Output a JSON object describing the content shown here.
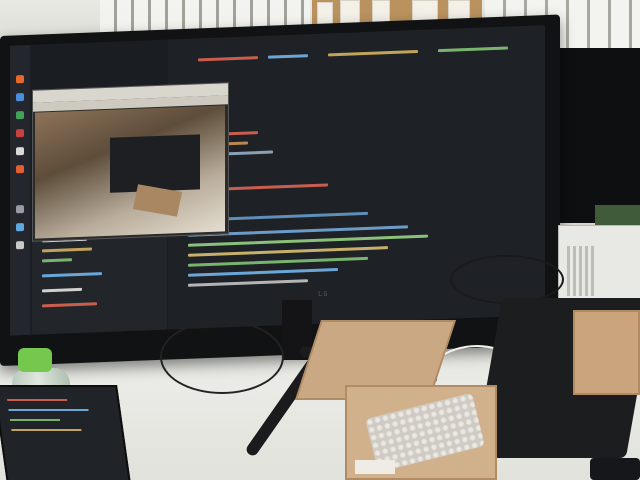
{
  "scene": {
    "description_visible_text": {
      "camera_window_title": "",
      "monitor_logo": "LG"
    }
  },
  "colors": {
    "screen_background": "#1a1d22",
    "cardboard": "#d1b08c",
    "bottle_cap": "#74c84d",
    "desk": "#e2e2dc"
  },
  "icons": [
    "dock-icon-orange",
    "dock-icon-blue",
    "dock-icon-green",
    "dock-icon-red"
  ]
}
